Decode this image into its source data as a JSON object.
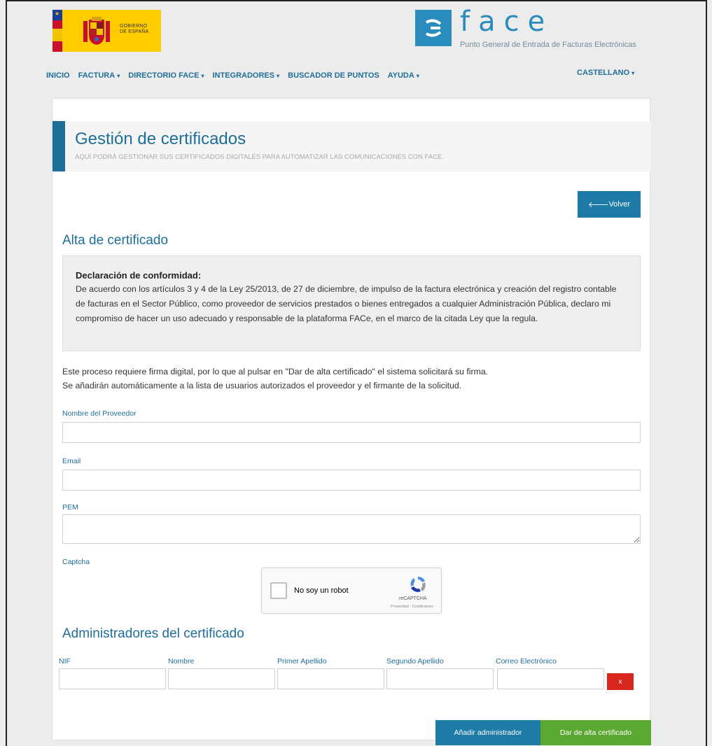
{
  "header": {
    "gob_logo_text_line1": "GOBIERNO",
    "gob_logo_text_line2": "DE ESPAÑA",
    "face_logo_letters": "face",
    "face_subtitle": "Punto General de Entrada de Facturas Electrónicas"
  },
  "nav": {
    "items": [
      {
        "label": "INICIO",
        "has_caret": false
      },
      {
        "label": "FACTURA",
        "has_caret": true
      },
      {
        "label": "DIRECTORIO FACE",
        "has_caret": true
      },
      {
        "label": "INTEGRADORES",
        "has_caret": true
      },
      {
        "label": "BUSCADOR DE PUNTOS",
        "has_caret": false
      },
      {
        "label": "AYUDA",
        "has_caret": true
      }
    ],
    "language": "CASTELLANO",
    "caret": "▾"
  },
  "page": {
    "title": "Gestión de certificados",
    "subtitle": "AQUÍ PODRÁ GESTIONAR SUS CERTIFICADOS DIGITALES PARA AUTOMATIZAR LAS COMUNICACIONES CON FACE.",
    "back_button": "Volver",
    "section_title": "Alta de certificado"
  },
  "declaration": {
    "title": "Declaración de conformidad:",
    "text": "De acuerdo con los artículos 3 y 4 de la Ley 25/2013, de 27 de diciembre, de impulso de la factura electrónica y creación del registro contable de facturas en el Sector Público, como proveedor de servicios prestados o bienes entregados a cualquier Administración Pública, declaro mi compromiso de hacer un uso adecuado y responsable de la plataforma FACe, en el marco de la citada Ley que la regula."
  },
  "info": {
    "line1": "Este proceso requiere firma digital, por lo que al pulsar en \"Dar de alta certificado\" el sistema solicitará su firma.",
    "line2": "Se añadirán automáticamente a la lista de usuarios autorizados el proveedor y el firmante de la solicitud."
  },
  "form": {
    "provider_label": "Nombre del Proveedor",
    "provider_value": "",
    "email_label": "Email",
    "email_value": "",
    "pem_label": "PEM",
    "pem_value": "",
    "captcha_label": "Captcha"
  },
  "captcha": {
    "checkbox_label": "No soy un robot",
    "brand": "reCAPTCHA",
    "terms": "Privacidad - Condiciones"
  },
  "admins": {
    "title": "Administradores del certificado",
    "columns": [
      "NIF",
      "Nombre",
      "Primer Apellido",
      "Segundo Apellido",
      "Correo Electrónico"
    ],
    "remove_button": "x"
  },
  "actions": {
    "add_admin": "Añadir administrador",
    "submit": "Dar de alta certificado"
  },
  "colors": {
    "primary": "#1e6e9a",
    "button_blue": "#1e7aa6",
    "button_green": "#5aa832",
    "button_red": "#d9261c",
    "gob_yellow": "#ffcc00"
  }
}
